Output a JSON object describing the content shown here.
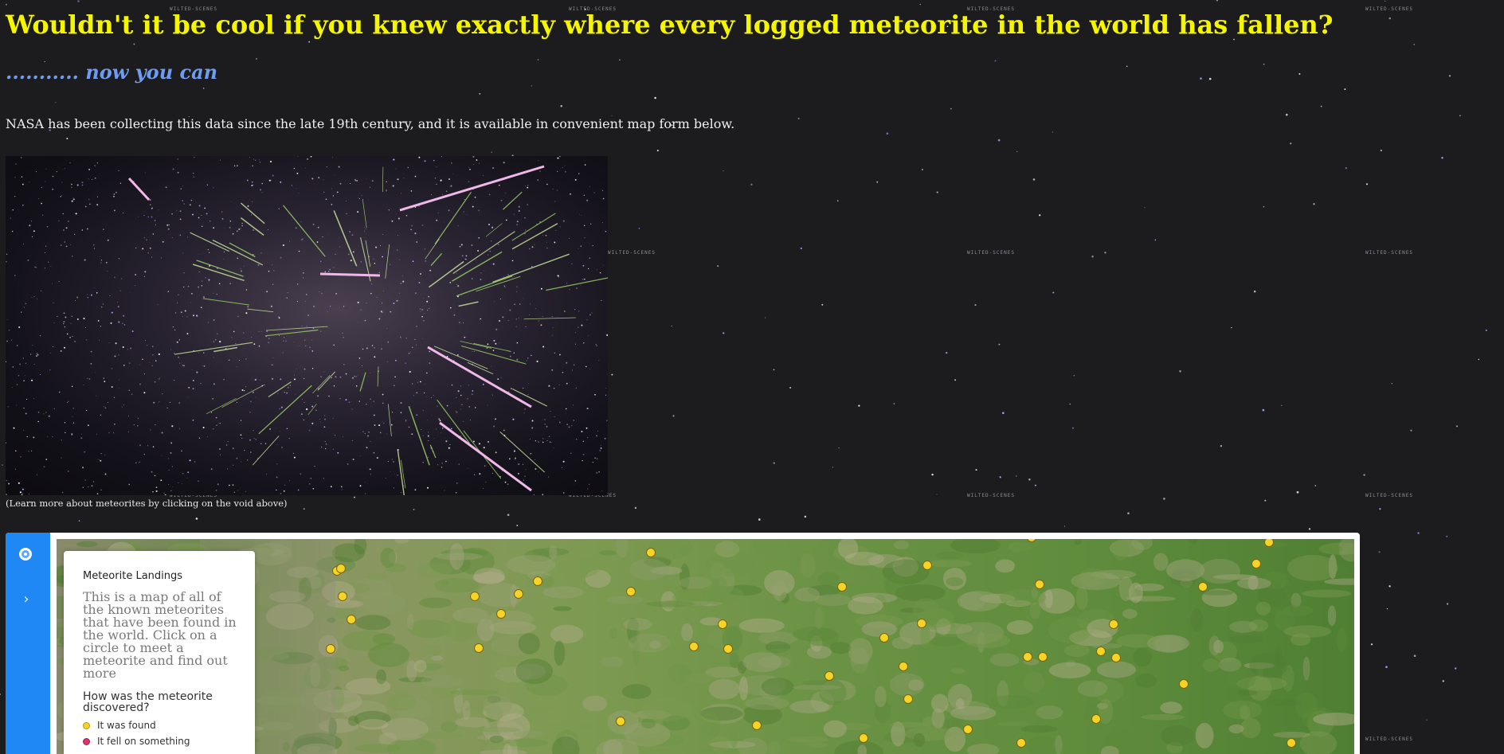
{
  "page": {
    "heading": "Wouldn't it be cool if you knew exactly where every logged meteorite in the world has fallen?",
    "subheading": "........... now you can",
    "intro": "NASA has been collecting this data since the late 19th century, and it is available in convenient map form below.",
    "image_caption": "(Learn more about meteorites by clicking on the void above)",
    "background_watermark": "WILTED-SCENES"
  },
  "map": {
    "legend": {
      "title": "Meteorite Landings",
      "description": "This is a map of all of the known meteorites that have been found in the world. Click on a circle to meet a meteorite and find out more",
      "question": "How was the meteorite discovered?",
      "items": [
        {
          "label": "It was found",
          "color": "#f5d327"
        },
        {
          "label": "It fell on something",
          "color": "#e0316a"
        }
      ]
    },
    "marker_color": "#f5d327",
    "sidebar_icons": [
      "layer-toggle-icon",
      "expand-chevron-icon"
    ]
  },
  "colors": {
    "heading": "#f5f500",
    "subheading": "#6f9bf0",
    "background": "#1c1c1e",
    "sidebar": "#1f88f5"
  }
}
